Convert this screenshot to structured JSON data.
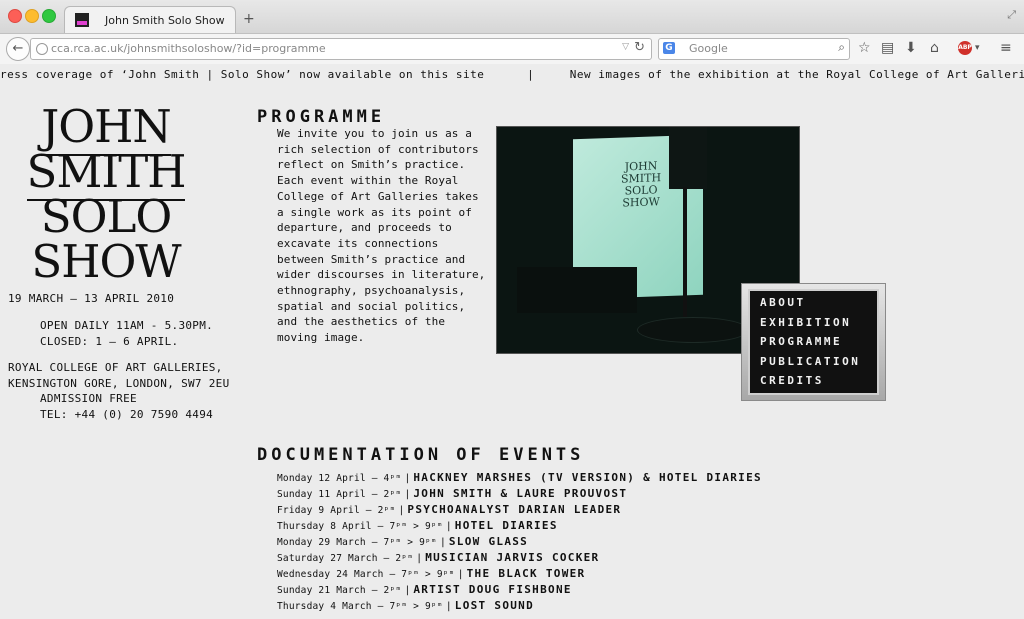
{
  "browser": {
    "tab_title": "John Smith Solo Show",
    "url": "cca.rca.ac.uk/johnsmithsoloshow/?id=programme",
    "search_placeholder": "Google",
    "new_tab_label": "+",
    "search_engine_letter": "G",
    "adblock_label": "ABP"
  },
  "ticker": {
    "text": "ress coverage of ‘John Smith | Solo Show’ now available on this site      |     New images of the exhibition at the Royal College of Art Galleries in the Exhibition"
  },
  "logo": {
    "lines": [
      "JOHN",
      "SMITH",
      "SOLO",
      "SHOW"
    ]
  },
  "info": {
    "dates": "19 MARCH — 13 APRIL 2010",
    "hours": "OPEN DAILY 11AM - 5.30PM.\nCLOSED: 1 — 6 APRIL.",
    "venue": "ROYAL COLLEGE OF ART GALLERIES,\nKENSINGTON GORE, LONDON, SW7 2EU",
    "contact": "ADMISSION FREE\nTEL: +44 (0) 20 7590 4494"
  },
  "programme": {
    "heading": "PROGRAMME",
    "text": "We invite you to join us as a rich selection of contributors reflect on Smith’s practice. Each event within the Royal College of Art Galleries takes a single work as its point of departure, and proceeds to excavate its connections between Smith’s practice and wider discourses in literature, ethnography, psychoanalysis, spatial and social politics, and the aesthetics of the moving image."
  },
  "photo": {
    "screen_title": "JOHN\nSMITH\nSOLO\nSHOW"
  },
  "menu": {
    "items": [
      "ABOUT",
      "EXHIBITION",
      "PROGRAMME",
      "PUBLICATION",
      "CREDITS"
    ]
  },
  "documentation": {
    "heading": "DOCUMENTATION OF EVENTS",
    "separator": "|",
    "events": [
      {
        "date": "Monday 12 April — 4ᵖᵐ",
        "title": "HACKNEY MARSHES (TV VERSION) & HOTEL DIARIES"
      },
      {
        "date": "Sunday 11 April — 2ᵖᵐ",
        "title": "JOHN SMITH & LAURE PROUVOST"
      },
      {
        "date": "Friday 9 April — 2ᵖᵐ",
        "title": "PSYCHOANALYST DARIAN LEADER"
      },
      {
        "date": "Thursday 8 April — 7ᵖᵐ > 9ᵖᵐ",
        "title": "HOTEL DIARIES"
      },
      {
        "date": "Monday 29 March — 7ᵖᵐ > 9ᵖᵐ",
        "title": "SLOW GLASS"
      },
      {
        "date": "Saturday 27 March — 2ᵖᵐ",
        "title": "MUSICIAN JARVIS COCKER"
      },
      {
        "date": "Wednesday 24 March — 7ᵖᵐ > 9ᵖᵐ",
        "title": "THE BLACK TOWER"
      },
      {
        "date": "Sunday 21 March — 2ᵖᵐ",
        "title": "ARTIST DOUG FISHBONE"
      },
      {
        "date": "Thursday 4 March — 7ᵖᵐ > 9ᵖᵐ",
        "title": "LOST SOUND"
      }
    ]
  }
}
